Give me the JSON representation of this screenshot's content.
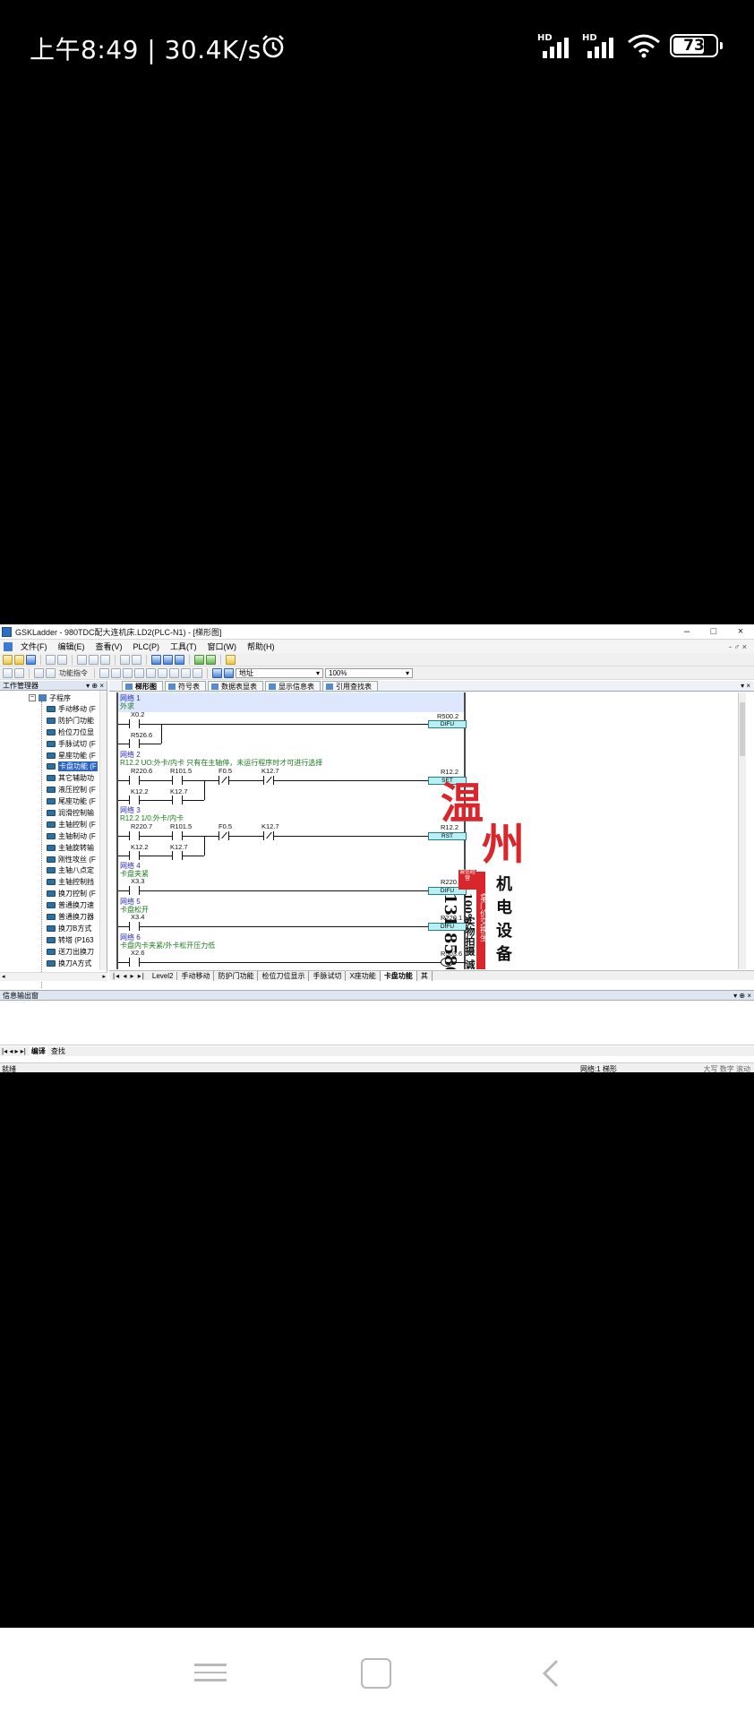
{
  "status_bar": {
    "time": "上午8:49 | 30.4K/s",
    "hd1": "HD",
    "hd2": "HD",
    "battery": "73",
    "battery_level_pct": 73
  },
  "app": {
    "title": "GSKLadder - 980TDC配大连机床.LD2(PLC-N1) - [梯形图]",
    "window_controls": [
      "–",
      "□",
      "×"
    ],
    "menu": [
      "文件(F)",
      "编辑(E)",
      "查看(V)",
      "PLC(P)",
      "工具(T)",
      "窗口(W)",
      "帮助(H)"
    ],
    "menu_right": "- ♂ ×",
    "toolbar2": {
      "label_func": "功能指令",
      "combo_addr": "地址",
      "combo_zoom": "100%"
    }
  },
  "project_pane": {
    "title": "工作管理器",
    "controls": "▾ ⊕ ×",
    "root_label": "子程序",
    "items": [
      "手动移动 (F",
      "防护门功能",
      "检位刀位显",
      "手脉试切 (F",
      "星座功能 (F",
      "卡盘功能 (F",
      "其它辅助功",
      "液压控制 (F",
      "尾座功能 (F",
      "润滑控制输",
      "主轴控制 (F",
      "主轴制动 (F",
      "主轴旋转输",
      "刚性攻丝 (F",
      "主轴八点定",
      "主轴控制挡",
      "换刀控制 (F",
      "普通换刀速",
      "普通换刀器",
      "换刀B方式",
      "转塔 (P163",
      "送刀出换刀",
      "换刀A方式"
    ],
    "selected_index": 5
  },
  "doc_tabs": [
    "梯形图",
    "符号表",
    "数据表显表",
    "显示信息表",
    "引用查找表"
  ],
  "doc_tabs_controls": "▾ ×",
  "ladder": {
    "networks": [
      {
        "title": "网络 1",
        "comment": "外求",
        "contacts": [
          "X0.2",
          "R526.6"
        ],
        "output_addr": "R500.2",
        "output_func": "DIFU"
      },
      {
        "title": "网络 2",
        "comment": "R12.2 UO:外卡/内卡 只有在主轴停，未运行程序时才可进行选择",
        "contacts": [
          "R220.6",
          "R101.5",
          "F0.5",
          "K12.7",
          "K12.2",
          "K12.7"
        ],
        "output_addr": "R12.2",
        "output_func": "SET"
      },
      {
        "title": "网络 3",
        "comment": "R12.2 1/0:外卡/内卡",
        "contacts": [
          "R220.7",
          "R101.5",
          "F0.5",
          "K12.7",
          "K12.2",
          "K12.7"
        ],
        "output_addr": "R12.2",
        "output_func": "RST"
      },
      {
        "title": "网络 4",
        "comment": "卡盘夹紧",
        "contacts": [
          "X3.3"
        ],
        "output_addr": "R220.0",
        "output_func": "DIFU"
      },
      {
        "title": "网络 5",
        "comment": "卡盘松开",
        "contacts": [
          "X3.4"
        ],
        "output_addr": "R220.1",
        "output_func": "DIFU"
      },
      {
        "title": "网络 6",
        "comment": "卡盘内卡夹紧/外卡松开压力低",
        "contacts": [
          "X2.6"
        ],
        "output_addr": "R503.6",
        "output_func": ""
      }
    ]
  },
  "watermark": {
    "big1": "温",
    "big2": "州",
    "col1": "机电设备",
    "col2": "拿门价交换坐",
    "col3": "实物拍摄 诚信经营",
    "col4": "100%",
    "phone": "131 8586 3202",
    "stamp": "诚信经营"
  },
  "sheet_tabs": {
    "nav": "|◂ ◂ ▸ ▸|",
    "tabs": [
      "Level2",
      "手动移动",
      "防护门功能",
      "检位刀位显示",
      "手脉试切",
      "X座功能",
      "卡盘功能",
      "其"
    ],
    "active_index": 6
  },
  "info_pane": {
    "title": "信息输出窗",
    "controls": "▾ ⊕ ×",
    "tabs_nav": "|◂ ◂ ▸ ▸|",
    "tabs": [
      "编译",
      "查找"
    ]
  },
  "status_line": {
    "left": "就绪",
    "middle": "网络:1  梯形",
    "right": "大写  数字  滚动"
  }
}
